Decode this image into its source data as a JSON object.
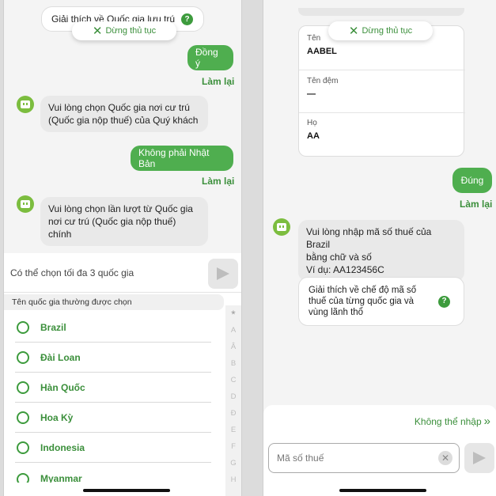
{
  "left": {
    "explain_residence": "Giải thích về Quốc gia lưu trú",
    "stop_label": "Dừng thủ tục",
    "user_msg_agree": "Đồng ý",
    "redo_1": "Làm lại",
    "bot_msg_1": "Vui lòng chọn Quốc gia nơi cư trú (Quốc gia nộp thuế) của Quý khách",
    "user_msg_not_japan": "Không phải Nhật Bản",
    "redo_2": "Làm lại",
    "bot_msg_2": "Vui lòng chọn lần lượt từ Quốc gia nơi cư trú (Quốc gia nộp thuế) chính",
    "country_input_text": "Có thể chọn tối đa 3 quốc gia",
    "section_title": "Tên quốc gia thường được chọn",
    "countries": [
      "Brazil",
      "Đài Loan",
      "Hàn Quốc",
      "Hoa Kỳ",
      "Indonesia",
      "Myanmar"
    ],
    "index_letters": [
      "*",
      "A",
      "Â",
      "B",
      "C",
      "D",
      "Đ",
      "E",
      "F",
      "G",
      "H"
    ]
  },
  "right": {
    "stop_label": "Dừng thủ tục",
    "name_label": "Tên",
    "name_value": "AABEL",
    "middle_label": "Tên đệm",
    "middle_value": "—",
    "last_label": "Họ",
    "last_value": "AA",
    "user_msg_correct": "Đúng",
    "redo": "Làm lại",
    "bot_msg_line1": "Vui lòng nhập mã số thuế của Brazil",
    "bot_msg_line2": "bằng chữ và số",
    "bot_msg_line3": "Ví dụ: AA123456C",
    "explain_tax": "Giải thích về chế độ mã số thuế của từng quốc gia và vùng lãnh thổ",
    "cannot_enter": "Không thể nhập",
    "tax_placeholder": "Mã số thuế"
  },
  "colors": {
    "accent": "#4fae4f",
    "accent_text": "#3b8f3b",
    "bot_avatar": "#7cbd3f"
  }
}
